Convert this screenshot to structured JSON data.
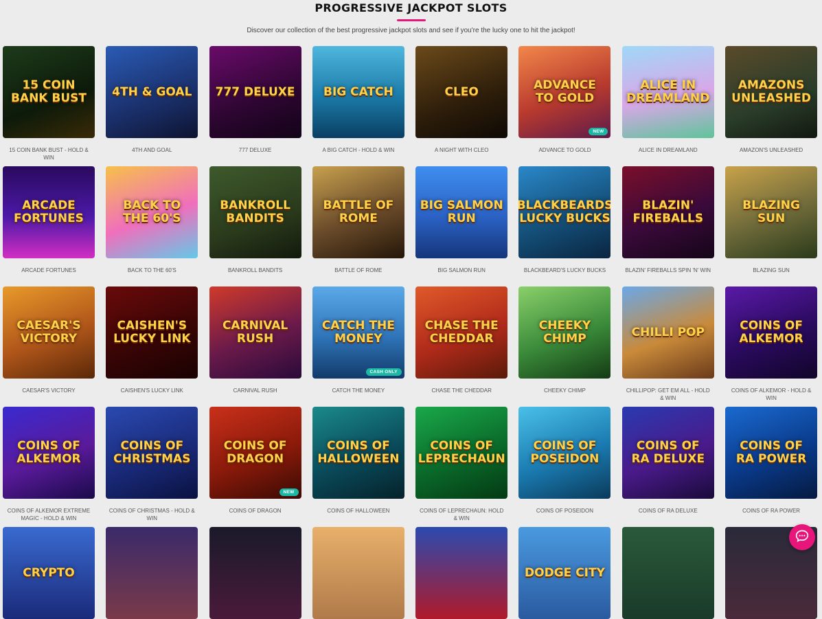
{
  "header": {
    "title": "PROGRESSIVE JACKPOT SLOTS",
    "subtitle": "Discover our collection of the best progressive jackpot slots and see if you're the lucky one to hit the jackpot!"
  },
  "accent_color": "#e8157a",
  "badge_color": "#1bb9a5",
  "games": [
    {
      "name": "15 COIN BANK BUST - HOLD & WIN",
      "art": "15 COIN BANK BUST",
      "bg": "linear-gradient(160deg,#1d3b1a,#0d1a0a 60%,#3a2a06)",
      "badge": ""
    },
    {
      "name": "4TH AND GOAL",
      "art": "4TH & GOAL",
      "bg": "linear-gradient(160deg,#2a5bb5,#1a2f6a 60%,#0e1430)",
      "badge": ""
    },
    {
      "name": "777 DELUXE",
      "art": "777 DELUXE",
      "bg": "linear-gradient(160deg,#6a0b6a,#2d0631 60%,#130318)",
      "badge": ""
    },
    {
      "name": "A BIG CATCH - HOLD & WIN",
      "art": "BIG CATCH",
      "bg": "linear-gradient(180deg,#4fb7dd,#1b7aa8 55%,#0a3f63)",
      "badge": ""
    },
    {
      "name": "A NIGHT WITH CLEO",
      "art": "CLEO",
      "bg": "linear-gradient(160deg,#6b4a1a,#2d1d0a 60%,#0f0a04)",
      "badge": ""
    },
    {
      "name": "ADVANCE TO GOLD",
      "art": "ADVANCE TO GOLD",
      "bg": "linear-gradient(160deg,#f2874a,#b83a2e 55%,#5e1a4a)",
      "badge": "NEW"
    },
    {
      "name": "ALICE IN DREAMLAND",
      "art": "Alice in Dreamland",
      "bg": "linear-gradient(170deg,#9fd8f7,#d9a7e8 55%,#5fc49a)",
      "badge": ""
    },
    {
      "name": "AMAZON'S UNLEASHED",
      "art": "AMAZONS UNLEASHED",
      "bg": "linear-gradient(160deg,#5a4a2a,#2a3d2a 60%,#12180f)",
      "badge": ""
    },
    {
      "name": "ARCADE FORTUNES",
      "art": "ARCADE FORTUNES",
      "bg": "linear-gradient(180deg,#2a0a5e,#4c19a8 55%,#d22ec2)",
      "badge": ""
    },
    {
      "name": "BACK TO THE 60'S",
      "art": "BACK TO THE 60'S",
      "bg": "linear-gradient(160deg,#f7c04a,#f06fbc 55%,#63c9e8)",
      "badge": ""
    },
    {
      "name": "BANKROLL BANDITS",
      "art": "BANKROLL BANDITS",
      "bg": "linear-gradient(160deg,#3e5a2c,#2a3a1c 60%,#13190c)",
      "badge": ""
    },
    {
      "name": "BATTLE OF ROME",
      "art": "BATTLE OF ROME",
      "bg": "linear-gradient(160deg,#c7a04e,#6a4b2a 55%,#241608)",
      "badge": ""
    },
    {
      "name": "BIG SALMON RUN",
      "art": "BIG SALMON RUN",
      "bg": "linear-gradient(180deg,#3f8ef0,#2a62c4 55%,#16357a)",
      "badge": ""
    },
    {
      "name": "BLACKBEARD'S LUCKY BUCKS",
      "art": "BLACKBEARDS LUCKY BUCKS",
      "bg": "linear-gradient(160deg,#2a88c9,#14507a 55%,#0a2540)",
      "badge": ""
    },
    {
      "name": "BLAZIN' FIREBALLS SPIN 'N' WIN",
      "art": "BLAZIN' FIREBALLS",
      "bg": "linear-gradient(160deg,#7a0f2a,#3a0a3a 55%,#150518)",
      "badge": ""
    },
    {
      "name": "BLAZING SUN",
      "art": "BLAZING SUN",
      "bg": "linear-gradient(160deg,#c9a24a,#6e6a3a 55%,#2a3a1a)",
      "badge": ""
    },
    {
      "name": "CAESAR'S VICTORY",
      "art": "CAESAR'S VICTORY",
      "bg": "linear-gradient(160deg,#e89a2a,#b0561a 55%,#5a2808)",
      "badge": ""
    },
    {
      "name": "CAISHEN'S LUCKY LINK",
      "art": "CAISHEN'S LUCKY LINK",
      "bg": "linear-gradient(160deg,#6a0a0a,#3a0505 55%,#1a0202)",
      "badge": ""
    },
    {
      "name": "CARNIVAL RUSH",
      "art": "CARNIVAL RUSH",
      "bg": "linear-gradient(160deg,#d03a2a,#6a1a4a 55%,#2a0a3a)",
      "badge": ""
    },
    {
      "name": "CATCH THE MONEY",
      "art": "CATCH THE MONEY",
      "bg": "linear-gradient(180deg,#5aa9e8,#2f74b8 55%,#123a6a)",
      "badge": "CASH ONLY"
    },
    {
      "name": "CHASE THE CHEDDAR",
      "art": "CHASE THE CHEDDAR",
      "bg": "linear-gradient(160deg,#e05a2a,#b02a1a 55%,#5a1a0a)",
      "badge": ""
    },
    {
      "name": "CHEEKY CHIMP",
      "art": "CHEEKY CHIMP",
      "bg": "linear-gradient(160deg,#8ad06a,#3a8a3a 55%,#143a14)",
      "badge": ""
    },
    {
      "name": "CHILLIPOP: GET EM ALL - HOLD & WIN",
      "art": "CHILLI POP",
      "bg": "linear-gradient(160deg,#6aa8e8,#c98a3a 55%,#6a3a1a)",
      "badge": ""
    },
    {
      "name": "COINS OF ALKEMOR - HOLD & WIN",
      "art": "COINS OF ALKEMOR",
      "bg": "linear-gradient(160deg,#5a1aa8,#2a0a5e 55%,#12052a)",
      "badge": ""
    },
    {
      "name": "COINS OF ALKEMOR EXTREME MAGIC - HOLD & WIN",
      "art": "COINS OF ALKEMOR",
      "bg": "linear-gradient(160deg,#3a2ad0,#5a1a9a 55%,#1a0a4a)",
      "badge": ""
    },
    {
      "name": "COINS OF CHRISTMAS - HOLD & WIN",
      "art": "COINS OF CHRISTMAS",
      "bg": "linear-gradient(160deg,#2a4ab0,#1a2a7a 55%,#0a1240)",
      "badge": ""
    },
    {
      "name": "COINS OF DRAGON",
      "art": "COINS OF DRAGON",
      "bg": "linear-gradient(160deg,#c9301a,#8a1a0a 55%,#3a0a04)",
      "badge": "NEW"
    },
    {
      "name": "COINS OF HALLOWEEN",
      "art": "COINS OF HALLOWEEN",
      "bg": "linear-gradient(160deg,#1a8a8a,#0a4a5a 55%,#05222a)",
      "badge": ""
    },
    {
      "name": "COINS OF LEPRECHAUN: HOLD & WIN",
      "art": "COINS OF LEPRECHAUN",
      "bg": "linear-gradient(160deg,#1aa84a,#0a6a2a 55%,#043a14)",
      "badge": ""
    },
    {
      "name": "COINS OF POSEIDON",
      "art": "COINS OF POSEIDON",
      "bg": "linear-gradient(160deg,#4ac0e8,#1a7ab0 55%,#0a3a5a)",
      "badge": ""
    },
    {
      "name": "COINS OF RA DELUXE",
      "art": "COINS OF RA DELUXE",
      "bg": "linear-gradient(160deg,#2a3ab0,#4a1a8a 55%,#1a0a3a)",
      "badge": ""
    },
    {
      "name": "COINS OF RA POWER",
      "art": "COINS OF RA POWER",
      "bg": "linear-gradient(160deg,#1a6ad0,#0a3a8a 55%,#051a40)",
      "badge": ""
    },
    {
      "name": "",
      "art": "CRYPTO",
      "bg": "linear-gradient(180deg,#3a6ad0,#1a2a7a)",
      "badge": ""
    },
    {
      "name": "",
      "art": "",
      "bg": "linear-gradient(180deg,#3a2a6a,#7a3a4a)",
      "badge": ""
    },
    {
      "name": "",
      "art": "",
      "bg": "linear-gradient(180deg,#1a1a2a,#4a1a3a)",
      "badge": ""
    },
    {
      "name": "",
      "art": "",
      "bg": "linear-gradient(180deg,#e8b06a,#b07a4a)",
      "badge": ""
    },
    {
      "name": "",
      "art": "",
      "bg": "linear-gradient(180deg,#2a4ab0,#b01a2a)",
      "badge": ""
    },
    {
      "name": "",
      "art": "DODGE CITY",
      "bg": "linear-gradient(180deg,#4a9ae0,#2a5aa0)",
      "badge": ""
    },
    {
      "name": "",
      "art": "",
      "bg": "linear-gradient(180deg,#2a5a3a,#1a3a2a)",
      "badge": ""
    },
    {
      "name": "",
      "art": "",
      "bg": "linear-gradient(180deg,#2a2a3a,#4a2a3a)",
      "badge": ""
    }
  ]
}
